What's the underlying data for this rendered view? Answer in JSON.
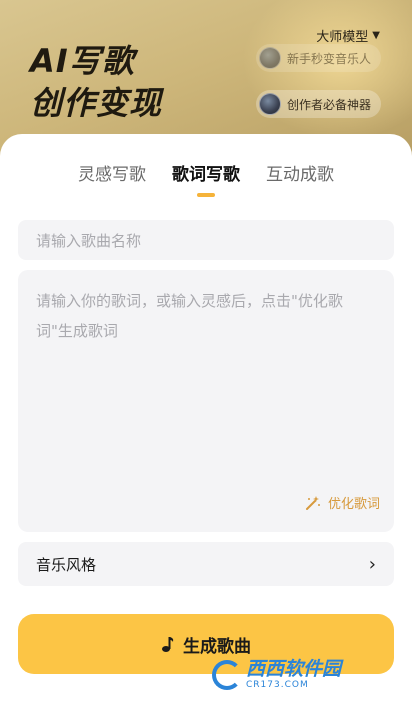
{
  "hero": {
    "title_line1": "AI写歌",
    "title_line2": "创作变现",
    "model_select": "大师模型",
    "pills": [
      {
        "label": "新手秒变音乐人"
      },
      {
        "label": "创作者必备神器"
      }
    ]
  },
  "tabs": [
    {
      "label": "灵感写歌",
      "active": false
    },
    {
      "label": "歌词写歌",
      "active": true
    },
    {
      "label": "互动成歌",
      "active": false
    }
  ],
  "form": {
    "song_name_placeholder": "请输入歌曲名称",
    "lyrics_placeholder": "请输入你的歌词，或输入灵感后，点击\"优化歌词\"生成歌词",
    "optimize_label": "优化歌词",
    "music_style_label": "音乐风格"
  },
  "generate_button": "生成歌曲",
  "watermark": {
    "main": "西西软件园",
    "sub": "CR173.COM"
  },
  "colors": {
    "accent": "#fcc545",
    "indicator": "#f5b33a",
    "optimize": "#d79a3d"
  }
}
